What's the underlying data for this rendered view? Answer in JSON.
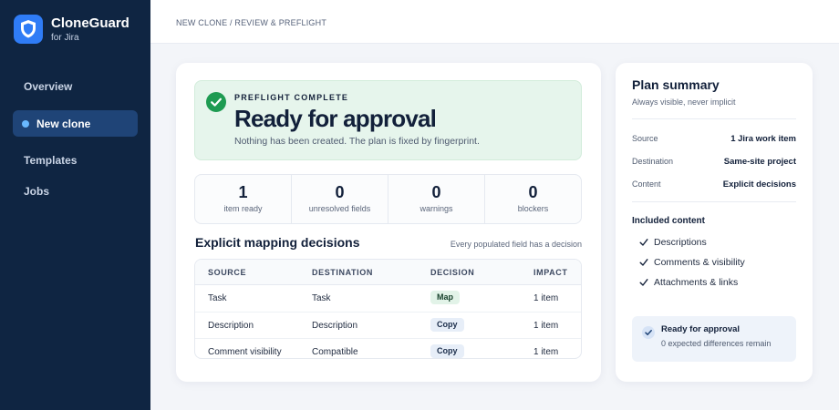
{
  "app": {
    "name": "CloneGuard",
    "subtitle": "for Jira",
    "accent": "#2f7cf6",
    "sidebar_bg": "#0f2542"
  },
  "sidebar": {
    "items": [
      {
        "label": "Overview",
        "active": false
      },
      {
        "label": "New clone",
        "active": true
      },
      {
        "label": "Templates",
        "active": false
      },
      {
        "label": "Jobs",
        "active": false
      }
    ]
  },
  "breadcrumb": "NEW CLONE / REVIEW & PREFLIGHT",
  "banner": {
    "eyebrow": "PREFLIGHT COMPLETE",
    "title": "Ready for approval",
    "description": "Nothing has been created. The plan is fixed by fingerprint.",
    "icon": "check-circle-icon",
    "color": "#1e9b52"
  },
  "stats": [
    {
      "value": "1",
      "label": "item ready"
    },
    {
      "value": "0",
      "label": "unresolved fields"
    },
    {
      "value": "0",
      "label": "warnings"
    },
    {
      "value": "0",
      "label": "blockers"
    }
  ],
  "mapping": {
    "title": "Explicit mapping decisions",
    "note": "Every populated field has a decision",
    "columns": [
      "SOURCE",
      "DESTINATION",
      "DECISION",
      "IMPACT"
    ],
    "rows": [
      {
        "source": "Task",
        "destination": "Task",
        "decision": "Map",
        "impact": "1 item"
      },
      {
        "source": "Description",
        "destination": "Description",
        "decision": "Copy",
        "impact": "1 item"
      },
      {
        "source": "Comment visibility",
        "destination": "Compatible",
        "decision": "Copy",
        "impact": "1 item"
      }
    ]
  },
  "summary": {
    "title": "Plan summary",
    "subtitle": "Always visible, never implicit",
    "rows": [
      {
        "label": "Source",
        "value": "1 Jira work item"
      },
      {
        "label": "Destination",
        "value": "Same-site project"
      },
      {
        "label": "Content",
        "value": "Explicit decisions"
      }
    ],
    "included_title": "Included content",
    "included": [
      "Descriptions",
      "Comments & visibility",
      "Attachments & links"
    ],
    "ready": {
      "title": "Ready for approval",
      "description": "0 expected differences remain"
    }
  }
}
